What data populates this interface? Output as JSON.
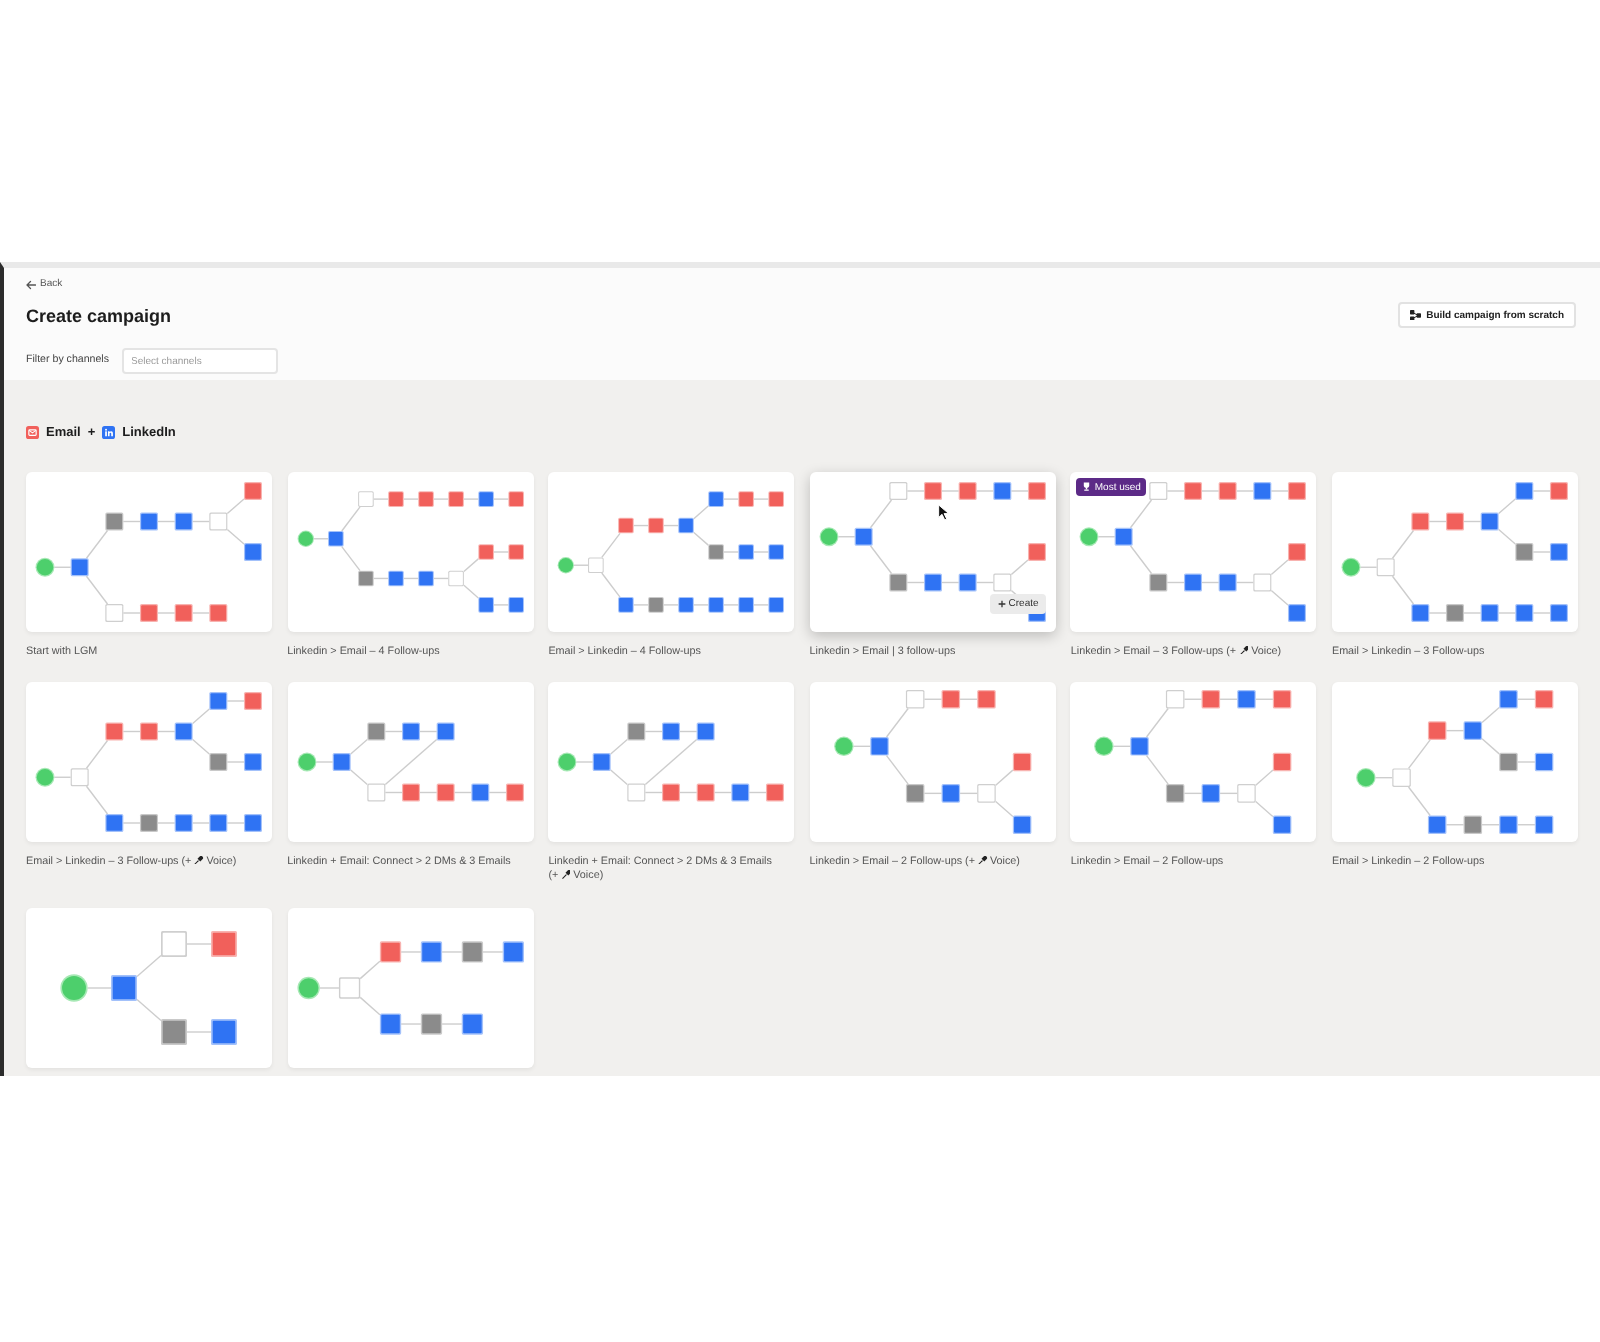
{
  "header": {
    "back": {
      "label": "Back"
    },
    "title": "Create campaign",
    "build_button": {
      "label": "Build campaign from scratch"
    },
    "filter": {
      "label": "Filter by channels",
      "placeholder": "Select channels"
    }
  },
  "section": {
    "channels": [
      {
        "kind": "email",
        "label": "Email"
      },
      {
        "kind": "linkedin",
        "label": "LinkedIn"
      }
    ],
    "joiner": "+"
  },
  "templates": [
    {
      "title": "Start with LGM",
      "hovered": false,
      "flow": {
        "kind": "start",
        "children": [
          {
            "kind": "linkedin",
            "children": [
              {
                "kind": "neutral",
                "children": [
                  {
                    "kind": "linkedin",
                    "children": [
                      {
                        "kind": "linkedin",
                        "children": [
                          {
                            "kind": "condition",
                            "children": [
                              {
                                "kind": "email"
                              },
                              {
                                "kind": "linkedin"
                              }
                            ]
                          }
                        ]
                      }
                    ]
                  }
                ]
              },
              {
                "kind": "condition",
                "children": [
                  {
                    "kind": "email",
                    "children": [
                      {
                        "kind": "email",
                        "children": [
                          {
                            "kind": "email"
                          }
                        ]
                      }
                    ]
                  }
                ]
              }
            ]
          }
        ]
      }
    },
    {
      "title": "Linkedin > Email – 4 Follow-ups",
      "hovered": false,
      "flow": {
        "kind": "start",
        "children": [
          {
            "kind": "linkedin",
            "children": [
              {
                "kind": "condition",
                "children": [
                  {
                    "kind": "email",
                    "children": [
                      {
                        "kind": "email",
                        "children": [
                          {
                            "kind": "email",
                            "children": [
                              {
                                "kind": "linkedin",
                                "children": [
                                  {
                                    "kind": "email"
                                  }
                                ]
                              }
                            ]
                          }
                        ]
                      }
                    ]
                  }
                ]
              },
              {
                "kind": "neutral",
                "children": [
                  {
                    "kind": "linkedin",
                    "children": [
                      {
                        "kind": "linkedin",
                        "children": [
                          {
                            "kind": "condition",
                            "children": [
                              {
                                "kind": "email",
                                "children": [
                                  {
                                    "kind": "email"
                                  }
                                ]
                              },
                              {
                                "kind": "linkedin",
                                "children": [
                                  {
                                    "kind": "linkedin"
                                  }
                                ]
                              }
                            ]
                          }
                        ]
                      }
                    ]
                  }
                ]
              }
            ]
          }
        ]
      }
    },
    {
      "title": "Email > Linkedin – 4 Follow-ups",
      "hovered": false,
      "flow": {
        "kind": "start",
        "children": [
          {
            "kind": "condition",
            "children": [
              {
                "kind": "email",
                "children": [
                  {
                    "kind": "email",
                    "children": [
                      {
                        "kind": "linkedin",
                        "children": [
                          {
                            "kind": "linkedin",
                            "children": [
                              {
                                "kind": "email",
                                "children": [
                                  {
                                    "kind": "email"
                                  }
                                ]
                              }
                            ]
                          },
                          {
                            "kind": "neutral",
                            "children": [
                              {
                                "kind": "linkedin",
                                "children": [
                                  {
                                    "kind": "linkedin"
                                  }
                                ]
                              }
                            ]
                          }
                        ]
                      }
                    ]
                  }
                ]
              },
              {
                "kind": "linkedin",
                "children": [
                  {
                    "kind": "neutral",
                    "children": [
                      {
                        "kind": "linkedin",
                        "children": [
                          {
                            "kind": "linkedin",
                            "children": [
                              {
                                "kind": "linkedin",
                                "children": [
                                  {
                                    "kind": "linkedin"
                                  }
                                ]
                              }
                            ]
                          }
                        ]
                      }
                    ]
                  }
                ]
              }
            ]
          }
        ]
      }
    },
    {
      "title": "Linkedin > Email | 3 follow-ups",
      "hovered": true,
      "action": {
        "label": "Create"
      },
      "flow": {
        "kind": "start",
        "children": [
          {
            "kind": "linkedin",
            "children": [
              {
                "kind": "condition",
                "children": [
                  {
                    "kind": "email",
                    "children": [
                      {
                        "kind": "email",
                        "children": [
                          {
                            "kind": "linkedin",
                            "children": [
                              {
                                "kind": "email"
                              }
                            ]
                          }
                        ]
                      }
                    ]
                  }
                ]
              },
              {
                "kind": "neutral",
                "children": [
                  {
                    "kind": "linkedin",
                    "children": [
                      {
                        "kind": "linkedin",
                        "children": [
                          {
                            "kind": "condition",
                            "children": [
                              {
                                "kind": "email"
                              },
                              {
                                "kind": "linkedin"
                              }
                            ]
                          }
                        ]
                      }
                    ]
                  }
                ]
              }
            ]
          }
        ]
      }
    },
    {
      "title": "Linkedin > Email – 3 Follow-ups",
      "addon": {
        "prefix": "(+",
        "label": "Voice)"
      },
      "hovered": false,
      "badge": {
        "label": "Most used"
      },
      "flow": {
        "kind": "start",
        "children": [
          {
            "kind": "linkedin",
            "children": [
              {
                "kind": "condition",
                "children": [
                  {
                    "kind": "email",
                    "children": [
                      {
                        "kind": "email",
                        "children": [
                          {
                            "kind": "linkedin",
                            "children": [
                              {
                                "kind": "email"
                              }
                            ]
                          }
                        ]
                      }
                    ]
                  }
                ]
              },
              {
                "kind": "neutral",
                "children": [
                  {
                    "kind": "linkedin",
                    "children": [
                      {
                        "kind": "linkedin",
                        "children": [
                          {
                            "kind": "condition",
                            "children": [
                              {
                                "kind": "email"
                              },
                              {
                                "kind": "linkedin"
                              }
                            ]
                          }
                        ]
                      }
                    ]
                  }
                ]
              }
            ]
          }
        ]
      }
    },
    {
      "title": "Email > Linkedin – 3 Follow-ups",
      "hovered": false,
      "flow": {
        "kind": "start",
        "children": [
          {
            "kind": "condition",
            "children": [
              {
                "kind": "email",
                "children": [
                  {
                    "kind": "email",
                    "children": [
                      {
                        "kind": "linkedin",
                        "children": [
                          {
                            "kind": "linkedin",
                            "children": [
                              {
                                "kind": "email"
                              }
                            ]
                          },
                          {
                            "kind": "neutral",
                            "children": [
                              {
                                "kind": "linkedin"
                              }
                            ]
                          }
                        ]
                      }
                    ]
                  }
                ]
              },
              {
                "kind": "linkedin",
                "children": [
                  {
                    "kind": "neutral",
                    "children": [
                      {
                        "kind": "linkedin",
                        "children": [
                          {
                            "kind": "linkedin",
                            "children": [
                              {
                                "kind": "linkedin"
                              }
                            ]
                          }
                        ]
                      }
                    ]
                  }
                ]
              }
            ]
          }
        ]
      }
    },
    {
      "title": "Email > Linkedin – 3 Follow-ups",
      "addon": {
        "prefix": "(+",
        "label": "Voice)"
      },
      "hovered": false,
      "flow": {
        "kind": "start",
        "children": [
          {
            "kind": "condition",
            "children": [
              {
                "kind": "email",
                "children": [
                  {
                    "kind": "email",
                    "children": [
                      {
                        "kind": "linkedin",
                        "children": [
                          {
                            "kind": "linkedin",
                            "children": [
                              {
                                "kind": "email"
                              }
                            ]
                          },
                          {
                            "kind": "neutral",
                            "children": [
                              {
                                "kind": "linkedin"
                              }
                            ]
                          }
                        ]
                      }
                    ]
                  }
                ]
              },
              {
                "kind": "linkedin",
                "children": [
                  {
                    "kind": "neutral",
                    "children": [
                      {
                        "kind": "linkedin",
                        "children": [
                          {
                            "kind": "linkedin",
                            "children": [
                              {
                                "kind": "linkedin"
                              }
                            ]
                          }
                        ]
                      }
                    ]
                  }
                ]
              }
            ]
          }
        ]
      }
    },
    {
      "title": "Linkedin + Email: Connect > 2 DMs & 3 Emails",
      "hovered": false,
      "flow": {
        "kind": "start",
        "children": [
          {
            "kind": "linkedin",
            "children": [
              {
                "kind": "neutral",
                "children": [
                  {
                    "kind": "linkedin",
                    "children": [
                      {
                        "kind": "linkedin",
                        "loops_back": true
                      }
                    ]
                  }
                ]
              },
              {
                "kind": "condition",
                "children": [
                  {
                    "kind": "email",
                    "children": [
                      {
                        "kind": "email",
                        "children": [
                          {
                            "kind": "linkedin",
                            "children": [
                              {
                                "kind": "email"
                              }
                            ]
                          }
                        ]
                      }
                    ]
                  }
                ]
              }
            ]
          }
        ]
      }
    },
    {
      "title": "Linkedin + Email: Connect > 2 DMs & 3 Emails",
      "addon": {
        "prefix": "(+",
        "label": "Voice)"
      },
      "hovered": false,
      "flow": {
        "kind": "start",
        "children": [
          {
            "kind": "linkedin",
            "children": [
              {
                "kind": "neutral",
                "children": [
                  {
                    "kind": "linkedin",
                    "children": [
                      {
                        "kind": "linkedin",
                        "loops_back": true
                      }
                    ]
                  }
                ]
              },
              {
                "kind": "condition",
                "children": [
                  {
                    "kind": "email",
                    "children": [
                      {
                        "kind": "email",
                        "children": [
                          {
                            "kind": "linkedin",
                            "children": [
                              {
                                "kind": "email"
                              }
                            ]
                          }
                        ]
                      }
                    ]
                  }
                ]
              }
            ]
          }
        ]
      }
    },
    {
      "title": "Linkedin > Email – 2 Follow-ups",
      "addon": {
        "prefix": "(+",
        "label": "Voice)"
      },
      "hovered": false,
      "flow": {
        "kind": "start",
        "children": [
          {
            "kind": "linkedin",
            "children": [
              {
                "kind": "condition",
                "children": [
                  {
                    "kind": "email",
                    "children": [
                      {
                        "kind": "email"
                      }
                    ]
                  }
                ]
              },
              {
                "kind": "neutral",
                "children": [
                  {
                    "kind": "linkedin",
                    "children": [
                      {
                        "kind": "condition",
                        "children": [
                          {
                            "kind": "email"
                          },
                          {
                            "kind": "linkedin"
                          }
                        ]
                      }
                    ]
                  }
                ]
              }
            ]
          }
        ]
      }
    },
    {
      "title": "Linkedin > Email – 2 Follow-ups",
      "hovered": false,
      "flow": {
        "kind": "start",
        "children": [
          {
            "kind": "linkedin",
            "children": [
              {
                "kind": "condition",
                "children": [
                  {
                    "kind": "email",
                    "children": [
                      {
                        "kind": "linkedin",
                        "children": [
                          {
                            "kind": "email"
                          }
                        ]
                      }
                    ]
                  }
                ]
              },
              {
                "kind": "neutral",
                "children": [
                  {
                    "kind": "linkedin",
                    "children": [
                      {
                        "kind": "condition",
                        "children": [
                          {
                            "kind": "email"
                          },
                          {
                            "kind": "linkedin"
                          }
                        ]
                      }
                    ]
                  }
                ]
              }
            ]
          }
        ]
      }
    },
    {
      "title": "Email > Linkedin – 2 Follow-ups",
      "hovered": false,
      "flow": {
        "kind": "start",
        "children": [
          {
            "kind": "condition",
            "children": [
              {
                "kind": "email",
                "children": [
                  {
                    "kind": "linkedin",
                    "children": [
                      {
                        "kind": "linkedin",
                        "children": [
                          {
                            "kind": "email"
                          }
                        ]
                      },
                      {
                        "kind": "neutral",
                        "children": [
                          {
                            "kind": "linkedin"
                          }
                        ]
                      }
                    ]
                  }
                ]
              },
              {
                "kind": "linkedin",
                "children": [
                  {
                    "kind": "neutral",
                    "children": [
                      {
                        "kind": "linkedin",
                        "children": [
                          {
                            "kind": "linkedin"
                          }
                        ]
                      }
                    ]
                  }
                ]
              }
            ]
          }
        ]
      }
    },
    {
      "hovered": false,
      "flow": {
        "kind": "start",
        "children": [
          {
            "kind": "linkedin",
            "children": [
              {
                "kind": "condition",
                "children": [
                  {
                    "kind": "email"
                  }
                ]
              },
              {
                "kind": "neutral",
                "children": [
                  {
                    "kind": "linkedin"
                  }
                ]
              }
            ]
          }
        ]
      }
    },
    {
      "hovered": false,
      "flow": {
        "kind": "start",
        "children": [
          {
            "kind": "condition",
            "children": [
              {
                "kind": "email",
                "children": [
                  {
                    "kind": "linkedin",
                    "children": [
                      {
                        "kind": "neutral",
                        "children": [
                          {
                            "kind": "linkedin"
                          }
                        ]
                      }
                    ]
                  }
                ]
              },
              {
                "kind": "linkedin",
                "children": [
                  {
                    "kind": "neutral",
                    "children": [
                      {
                        "kind": "linkedin"
                      }
                    ]
                  }
                ]
              }
            ]
          }
        ]
      }
    }
  ]
}
